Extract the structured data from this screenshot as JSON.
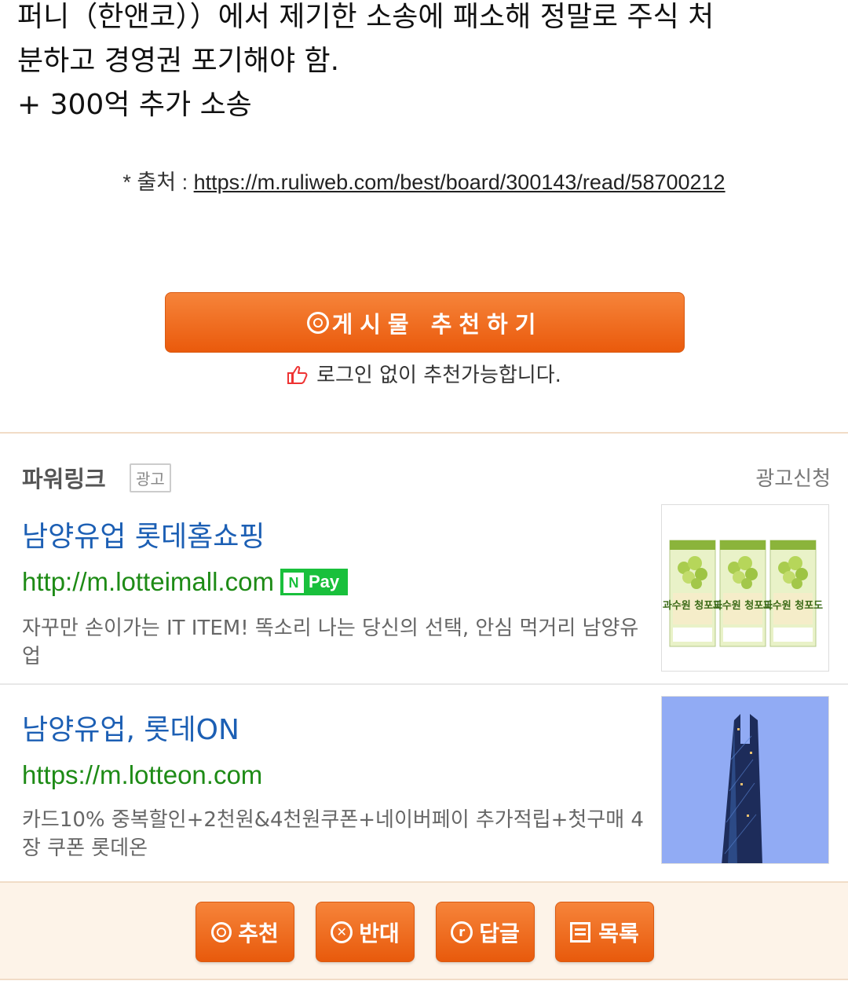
{
  "article": {
    "line1": "퍼니（한앤코））에서 제기한 소송에 패소해 정말로 주식 처",
    "line2": "분하고 경영권 포기해야 함.",
    "line3": "+ 300억 추가 소송",
    "source_label": "* 출처 : ",
    "source_url": "https://m.ruliweb.com/best/board/300143/read/58700212"
  },
  "recommend": {
    "button_label": "게시물 추천하기",
    "note": "로그인 없이 추천가능합니다."
  },
  "powerlink": {
    "title": "파워링크",
    "ad_badge": "광고",
    "apply": "광고신청",
    "ads": [
      {
        "title": "남양유업 롯데홈쇼핑",
        "url": "http://m.lotteimall.com",
        "pay_badge": "Pay",
        "pay_letter": "N",
        "desc": "자꾸만 손이가는 IT ITEM! 똑소리 나는 당신의 선택, 안심 먹거리 남양유업",
        "image": "과수원 청포도",
        "image_icon": "grape-juice-box-image"
      },
      {
        "title": "남양유업, 롯데ON",
        "url": "https://m.lotteon.com",
        "desc": "카드10% 중복할인+2천원&4천원쿠폰+네이버페이 추가적립+첫구매 4장 쿠폰 롯데온",
        "image_icon": "tower-building-image"
      }
    ]
  },
  "bottom": {
    "recommend": "추천",
    "oppose": "반대",
    "reply": "답글",
    "list": "목록"
  },
  "colors": {
    "accent_orange": "#ea5a0c",
    "ad_title": "#1c5fb4",
    "ad_url": "#1e8b16"
  }
}
